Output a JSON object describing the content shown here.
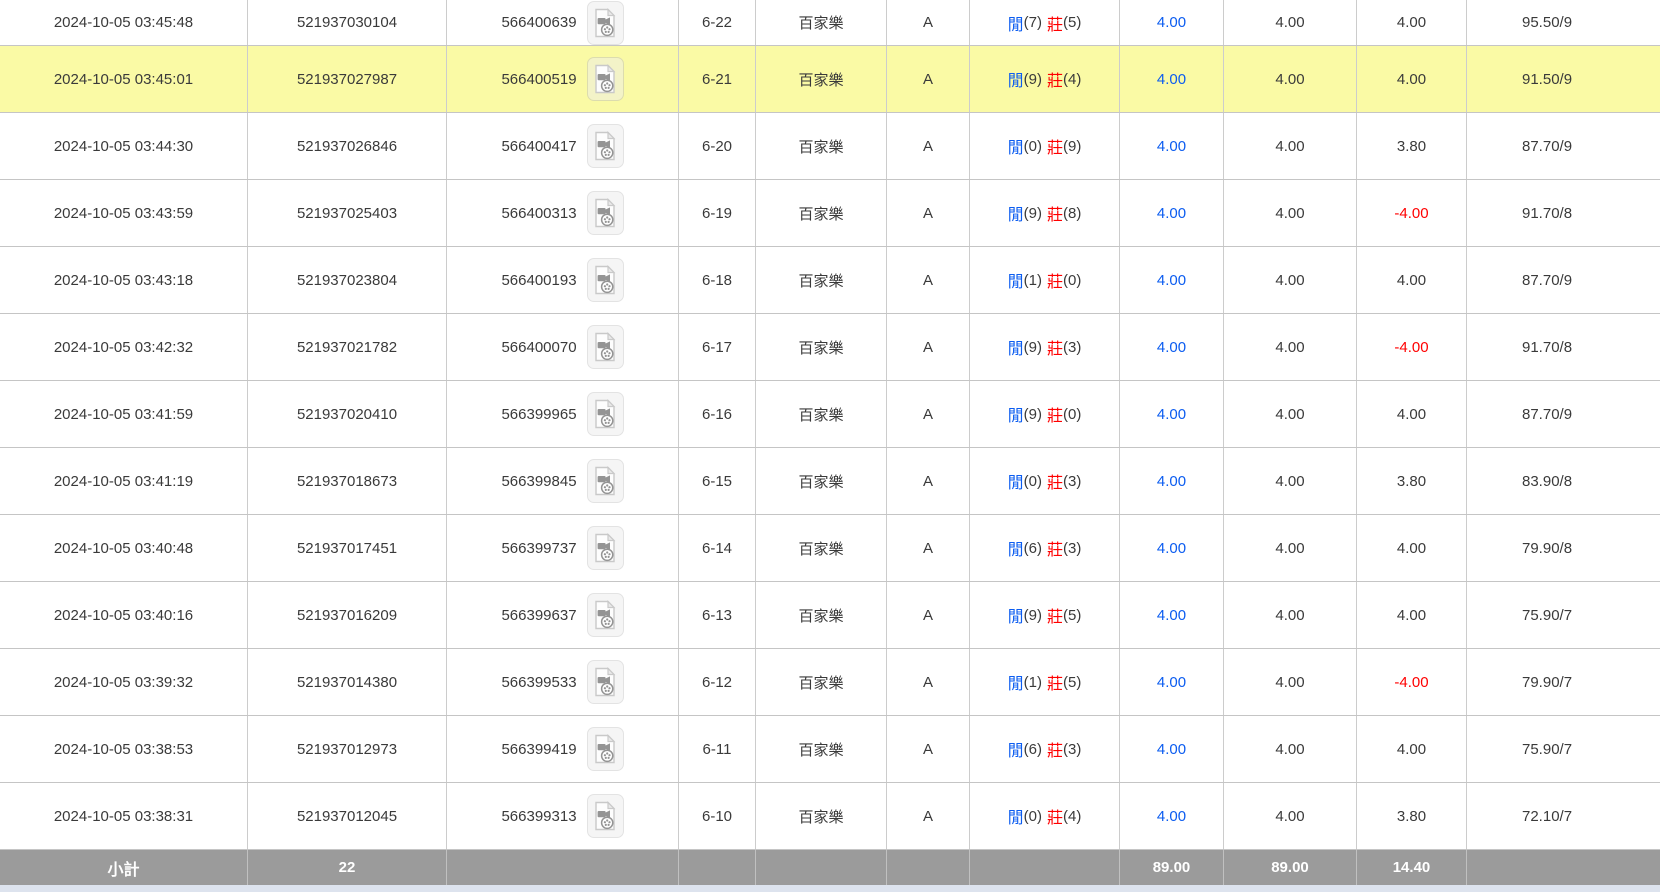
{
  "result_labels": {
    "player": "閒",
    "banker": "莊"
  },
  "icons": {
    "video_replay": "video-replay-icon"
  },
  "colors": {
    "accent_blue": "#0b5cf0",
    "loss_red": "#ff0000",
    "highlight_yellow": "#fafaa5",
    "subtotal_gray": "#9b9b9b",
    "footer_strip": "#dde3ee",
    "text": "#3a3a3a"
  },
  "subtotal": {
    "label": "小計",
    "count": "22",
    "bet_total": "89.00",
    "valid_bet_total": "89.00",
    "win_loss_total": "14.40"
  },
  "rows": [
    {
      "time": "2024-10-05 03:45:48",
      "bet_id": "521937030104",
      "game_id": "566400639",
      "round": "6-22",
      "game": "百家樂",
      "table": "A",
      "player": "(7)",
      "banker": "(5)",
      "bet": "4.00",
      "valid_bet": "4.00",
      "win_loss": "4.00",
      "balance": "95.50/9",
      "highlighted": false
    },
    {
      "time": "2024-10-05 03:45:01",
      "bet_id": "521937027987",
      "game_id": "566400519",
      "round": "6-21",
      "game": "百家樂",
      "table": "A",
      "player": "(9)",
      "banker": "(4)",
      "bet": "4.00",
      "valid_bet": "4.00",
      "win_loss": "4.00",
      "balance": "91.50/9",
      "highlighted": true
    },
    {
      "time": "2024-10-05 03:44:30",
      "bet_id": "521937026846",
      "game_id": "566400417",
      "round": "6-20",
      "game": "百家樂",
      "table": "A",
      "player": "(0)",
      "banker": "(9)",
      "bet": "4.00",
      "valid_bet": "4.00",
      "win_loss": "3.80",
      "balance": "87.70/9",
      "highlighted": false
    },
    {
      "time": "2024-10-05 03:43:59",
      "bet_id": "521937025403",
      "game_id": "566400313",
      "round": "6-19",
      "game": "百家樂",
      "table": "A",
      "player": "(9)",
      "banker": "(8)",
      "bet": "4.00",
      "valid_bet": "4.00",
      "win_loss": "-4.00",
      "balance": "91.70/8",
      "highlighted": false
    },
    {
      "time": "2024-10-05 03:43:18",
      "bet_id": "521937023804",
      "game_id": "566400193",
      "round": "6-18",
      "game": "百家樂",
      "table": "A",
      "player": "(1)",
      "banker": "(0)",
      "bet": "4.00",
      "valid_bet": "4.00",
      "win_loss": "4.00",
      "balance": "87.70/9",
      "highlighted": false
    },
    {
      "time": "2024-10-05 03:42:32",
      "bet_id": "521937021782",
      "game_id": "566400070",
      "round": "6-17",
      "game": "百家樂",
      "table": "A",
      "player": "(9)",
      "banker": "(3)",
      "bet": "4.00",
      "valid_bet": "4.00",
      "win_loss": "-4.00",
      "balance": "91.70/8",
      "highlighted": false
    },
    {
      "time": "2024-10-05 03:41:59",
      "bet_id": "521937020410",
      "game_id": "566399965",
      "round": "6-16",
      "game": "百家樂",
      "table": "A",
      "player": "(9)",
      "banker": "(0)",
      "bet": "4.00",
      "valid_bet": "4.00",
      "win_loss": "4.00",
      "balance": "87.70/9",
      "highlighted": false
    },
    {
      "time": "2024-10-05 03:41:19",
      "bet_id": "521937018673",
      "game_id": "566399845",
      "round": "6-15",
      "game": "百家樂",
      "table": "A",
      "player": "(0)",
      "banker": "(3)",
      "bet": "4.00",
      "valid_bet": "4.00",
      "win_loss": "3.80",
      "balance": "83.90/8",
      "highlighted": false
    },
    {
      "time": "2024-10-05 03:40:48",
      "bet_id": "521937017451",
      "game_id": "566399737",
      "round": "6-14",
      "game": "百家樂",
      "table": "A",
      "player": "(6)",
      "banker": "(3)",
      "bet": "4.00",
      "valid_bet": "4.00",
      "win_loss": "4.00",
      "balance": "79.90/8",
      "highlighted": false
    },
    {
      "time": "2024-10-05 03:40:16",
      "bet_id": "521937016209",
      "game_id": "566399637",
      "round": "6-13",
      "game": "百家樂",
      "table": "A",
      "player": "(9)",
      "banker": "(5)",
      "bet": "4.00",
      "valid_bet": "4.00",
      "win_loss": "4.00",
      "balance": "75.90/7",
      "highlighted": false
    },
    {
      "time": "2024-10-05 03:39:32",
      "bet_id": "521937014380",
      "game_id": "566399533",
      "round": "6-12",
      "game": "百家樂",
      "table": "A",
      "player": "(1)",
      "banker": "(5)",
      "bet": "4.00",
      "valid_bet": "4.00",
      "win_loss": "-4.00",
      "balance": "79.90/7",
      "highlighted": false
    },
    {
      "time": "2024-10-05 03:38:53",
      "bet_id": "521937012973",
      "game_id": "566399419",
      "round": "6-11",
      "game": "百家樂",
      "table": "A",
      "player": "(6)",
      "banker": "(3)",
      "bet": "4.00",
      "valid_bet": "4.00",
      "win_loss": "4.00",
      "balance": "75.90/7",
      "highlighted": false
    },
    {
      "time": "2024-10-05 03:38:31",
      "bet_id": "521937012045",
      "game_id": "566399313",
      "round": "6-10",
      "game": "百家樂",
      "table": "A",
      "player": "(0)",
      "banker": "(4)",
      "bet": "4.00",
      "valid_bet": "4.00",
      "win_loss": "3.80",
      "balance": "72.10/7",
      "highlighted": false
    }
  ]
}
